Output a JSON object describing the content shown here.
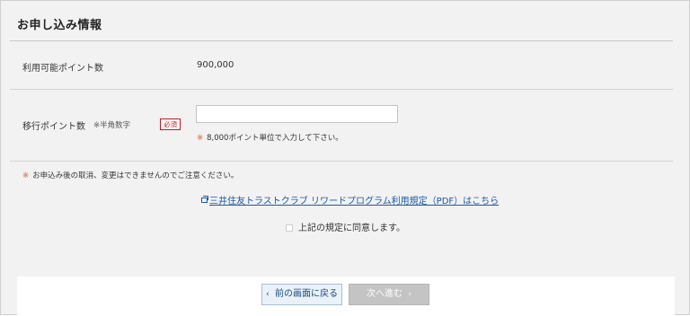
{
  "section_title": "お申し込み情報",
  "available_points": {
    "label": "利用可能ポイント数",
    "value": "900,000"
  },
  "transfer_points": {
    "label": "移行ポイント数",
    "hint": "※半角数字",
    "required_badge": "必須",
    "input_value": "",
    "note_mark": "※",
    "note": "8,000ポイント単位で入力して下さい。"
  },
  "cancel_notice": {
    "mark": "※",
    "text": "お申込み後の取消、変更はできませんのでご注意ください。"
  },
  "terms_link": {
    "text": "三井住友トラストクラブ リワードプログラム利用規定（PDF）はこちら",
    "icon": "external-window-icon"
  },
  "agree_checkbox": {
    "label": "上記の規定に同意します。",
    "checked": false
  },
  "buttons": {
    "back": {
      "label": "前の画面に戻る",
      "icon": "chevron-left-icon"
    },
    "next": {
      "label": "次へ進む",
      "icon": "chevron-right-icon",
      "disabled": true
    }
  },
  "colors": {
    "required": "#c4161c",
    "link": "#1a5aa8",
    "note_mark": "#e25a2b",
    "disabled_button": "#c4c4c4"
  }
}
